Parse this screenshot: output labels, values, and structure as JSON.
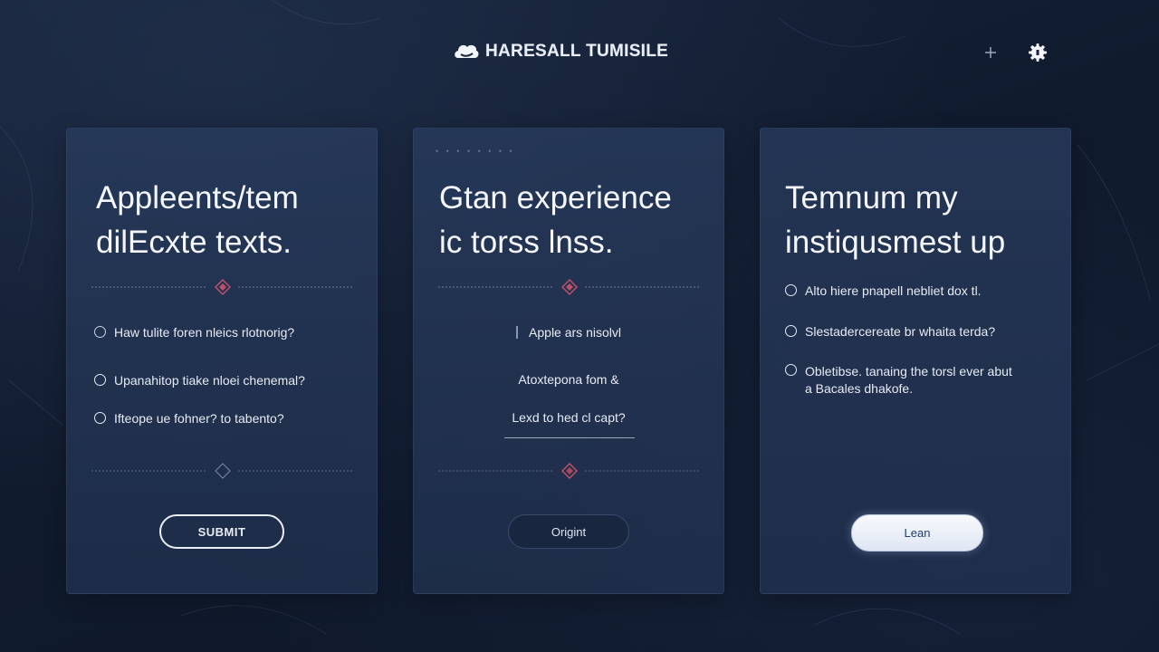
{
  "header": {
    "brand_name": "HARESALL TUMISILE",
    "icons": {
      "logo": "cloud-logo",
      "add": "plus-icon",
      "settings": "gear-icon"
    }
  },
  "cards": [
    {
      "title_line1": "Appleents/tem",
      "title_line2": "dilEcxte texts.",
      "options": [
        "Haw tulite foren nleics rlotnorig?",
        "Upanahitop tiake nloei chenemal?",
        "Ifteope ue fohner? to tabento?"
      ],
      "button_label": "SUBMIT"
    },
    {
      "dots": "• • • • • • • •",
      "title_line1": "Gtan experience",
      "title_line2": "ic torss lnss.",
      "items": [
        "Apple ars nisolvl",
        "Atoxtepona fom &",
        "Lexd to hed cl capt?"
      ],
      "button_label": "Origint"
    },
    {
      "title_line1": "Temnum my",
      "title_line2": "instiqusmest up",
      "options": [
        "Alto hiere pnapell nebliet dox tl.",
        "Slestadercereate br whaita terda?",
        "Obletibse. tanaing the torsl ever abut",
        "a Bacales dhakofe."
      ],
      "button_label": "Lean"
    }
  ],
  "colors": {
    "background": "#111c2f",
    "card": "#26395a",
    "accent_diamond": "#c0506a",
    "button_light": "#f2f5fb",
    "button_light_text": "#1f3d6e"
  }
}
